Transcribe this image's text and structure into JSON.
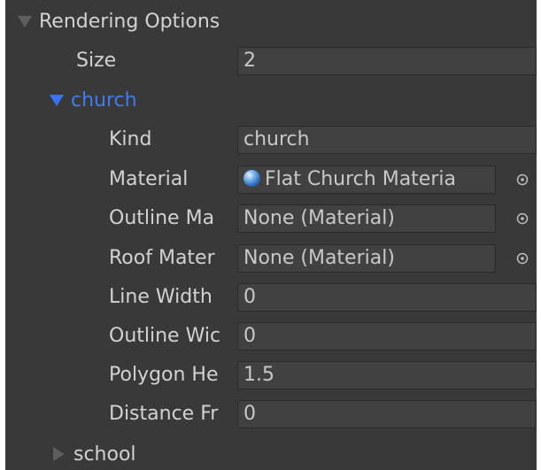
{
  "section": {
    "title": "Rendering Options",
    "size_label": "Size",
    "size_value": "2"
  },
  "church": {
    "title": "church",
    "fields": [
      {
        "label": "Kind",
        "value": "church"
      },
      {
        "label": "Material",
        "value": "Flat Church Materia"
      },
      {
        "label": "Outline Ma",
        "value": "None (Material)"
      },
      {
        "label": "Roof Mater",
        "value": "None (Material)"
      },
      {
        "label": "Line Width",
        "value": "0"
      },
      {
        "label": "Outline Wic",
        "value": "0"
      },
      {
        "label": "Polygon He",
        "value": "1.5"
      },
      {
        "label": "Distance Fr",
        "value": "0"
      }
    ]
  },
  "school": {
    "title": "school"
  },
  "colors": {
    "panel_bg": "#393939",
    "field_bg": "#414141",
    "label_text": "#d2d2d2",
    "accent_blue": "#3e7cf5"
  },
  "icons": {
    "expanded": "triangle-down-icon",
    "collapsed": "triangle-right-icon",
    "material": "material-sphere-icon",
    "object_picker": "object-picker-icon"
  }
}
